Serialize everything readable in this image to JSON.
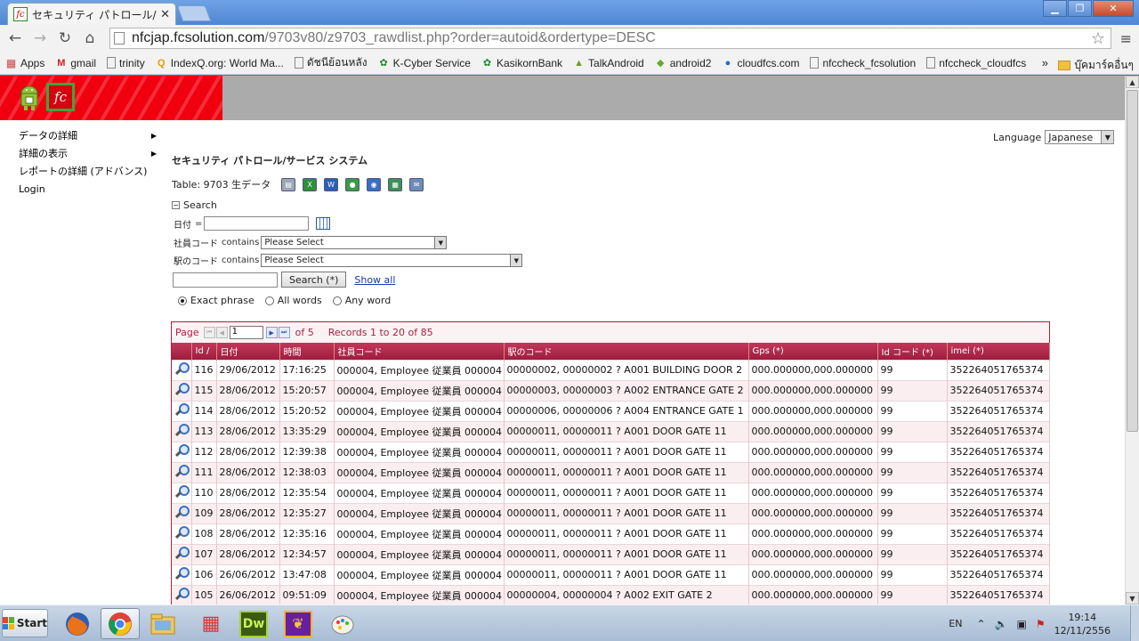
{
  "browser": {
    "tab_title": "セキュリティ パトロール/サ",
    "url_host": "nfcjap.fcsolution.com",
    "url_path": "/9703v80/z9703_rawdlist.php?order=autoid&ordertype=DESC",
    "bookmarks": [
      "Apps",
      "gmail",
      "trinity",
      "IndexQ.org: World Ma...",
      "ดัชนีย้อนหลัง",
      "K-Cyber Service",
      "KasikornBank",
      "TalkAndroid",
      "android2",
      "cloudfcs.com",
      "nfccheck_fcsolution",
      "nfccheck_cloudfcs"
    ],
    "bookmarks_more": "»",
    "other_bookmarks": "บุ๊คมาร์คอื่นๆ"
  },
  "sidebar": {
    "items": [
      {
        "label": "データの詳細"
      },
      {
        "label": "詳細の表示"
      },
      {
        "label": "レポートの詳細 (アドバンス)"
      },
      {
        "label": "Login"
      }
    ]
  },
  "language": {
    "label": "Language",
    "value": "Japanese"
  },
  "page": {
    "title": "セキュリティ パトロール/サービス システム",
    "table_label": "Table: 9703 生データ"
  },
  "search": {
    "header": "Search",
    "date_label": "日付",
    "date_op": "=",
    "employee_label": "社員コード",
    "employee_op": "contains",
    "employee_select": "Please Select",
    "station_label": "駅のコード",
    "station_op": "contains",
    "station_select": "Please Select",
    "button": "Search (*)",
    "show_all": "Show all",
    "options": [
      "Exact phrase",
      "All words",
      "Any word"
    ]
  },
  "pager": {
    "page_label": "Page",
    "page_value": "1",
    "of_label": "of 5",
    "records": "Records 1 to 20 of 85"
  },
  "table": {
    "columns": [
      "Id",
      "日付",
      "時間",
      "社員コード",
      "駅のコード",
      "Gps (*)",
      "Id コード (*)",
      "imei (*)"
    ],
    "sort_marker": "/",
    "rows": [
      {
        "id": "116",
        "date": "29/06/2012",
        "time": "17:16:25",
        "emp": "000004, Employee 従業員 000004",
        "station": "00000002, 00000002 ? A001 BUILDING DOOR 2",
        "gps": "000.000000,000.000000",
        "idcode": "99",
        "imei": "352264051765374"
      },
      {
        "id": "115",
        "date": "28/06/2012",
        "time": "15:20:57",
        "emp": "000004, Employee 従業員 000004",
        "station": "00000003, 00000003 ? A002 ENTRANCE GATE 2",
        "gps": "000.000000,000.000000",
        "idcode": "99",
        "imei": "352264051765374"
      },
      {
        "id": "114",
        "date": "28/06/2012",
        "time": "15:20:52",
        "emp": "000004, Employee 従業員 000004",
        "station": "00000006, 00000006 ? A004 ENTRANCE GATE 1",
        "gps": "000.000000,000.000000",
        "idcode": "99",
        "imei": "352264051765374"
      },
      {
        "id": "113",
        "date": "28/06/2012",
        "time": "13:35:29",
        "emp": "000004, Employee 従業員 000004",
        "station": "00000011, 00000011 ? A001 DOOR GATE 11",
        "gps": "000.000000,000.000000",
        "idcode": "99",
        "imei": "352264051765374"
      },
      {
        "id": "112",
        "date": "28/06/2012",
        "time": "12:39:38",
        "emp": "000004, Employee 従業員 000004",
        "station": "00000011, 00000011 ? A001 DOOR GATE 11",
        "gps": "000.000000,000.000000",
        "idcode": "99",
        "imei": "352264051765374"
      },
      {
        "id": "111",
        "date": "28/06/2012",
        "time": "12:38:03",
        "emp": "000004, Employee 従業員 000004",
        "station": "00000011, 00000011 ? A001 DOOR GATE 11",
        "gps": "000.000000,000.000000",
        "idcode": "99",
        "imei": "352264051765374"
      },
      {
        "id": "110",
        "date": "28/06/2012",
        "time": "12:35:54",
        "emp": "000004, Employee 従業員 000004",
        "station": "00000011, 00000011 ? A001 DOOR GATE 11",
        "gps": "000.000000,000.000000",
        "idcode": "99",
        "imei": "352264051765374"
      },
      {
        "id": "109",
        "date": "28/06/2012",
        "time": "12:35:27",
        "emp": "000004, Employee 従業員 000004",
        "station": "00000011, 00000011 ? A001 DOOR GATE 11",
        "gps": "000.000000,000.000000",
        "idcode": "99",
        "imei": "352264051765374"
      },
      {
        "id": "108",
        "date": "28/06/2012",
        "time": "12:35:16",
        "emp": "000004, Employee 従業員 000004",
        "station": "00000011, 00000011 ? A001 DOOR GATE 11",
        "gps": "000.000000,000.000000",
        "idcode": "99",
        "imei": "352264051765374"
      },
      {
        "id": "107",
        "date": "28/06/2012",
        "time": "12:34:57",
        "emp": "000004, Employee 従業員 000004",
        "station": "00000011, 00000011 ? A001 DOOR GATE 11",
        "gps": "000.000000,000.000000",
        "idcode": "99",
        "imei": "352264051765374"
      },
      {
        "id": "106",
        "date": "26/06/2012",
        "time": "13:47:08",
        "emp": "000004, Employee 従業員 000004",
        "station": "00000011, 00000011 ? A001 DOOR GATE 11",
        "gps": "000.000000,000.000000",
        "idcode": "99",
        "imei": "352264051765374"
      },
      {
        "id": "105",
        "date": "26/06/2012",
        "time": "09:51:09",
        "emp": "000004, Employee 従業員 000004",
        "station": "00000004, 00000004 ? A002 EXIT GATE 2",
        "gps": "000.000000,000.000000",
        "idcode": "99",
        "imei": "352264051765374"
      }
    ]
  },
  "taskbar": {
    "start": "Start",
    "apps": [
      "firefox-icon",
      "chrome-icon",
      "explorer-icon",
      "apps-grid-icon",
      "dreamweaver-icon",
      "book-icon",
      "paint-icon"
    ],
    "dw_label": "Dw",
    "lang": "EN",
    "time": "19:14",
    "date": "12/11/2556"
  },
  "colors": {
    "brand_red": "#f0000e",
    "grid_header": "#a3243f",
    "link": "#1a39a8"
  }
}
